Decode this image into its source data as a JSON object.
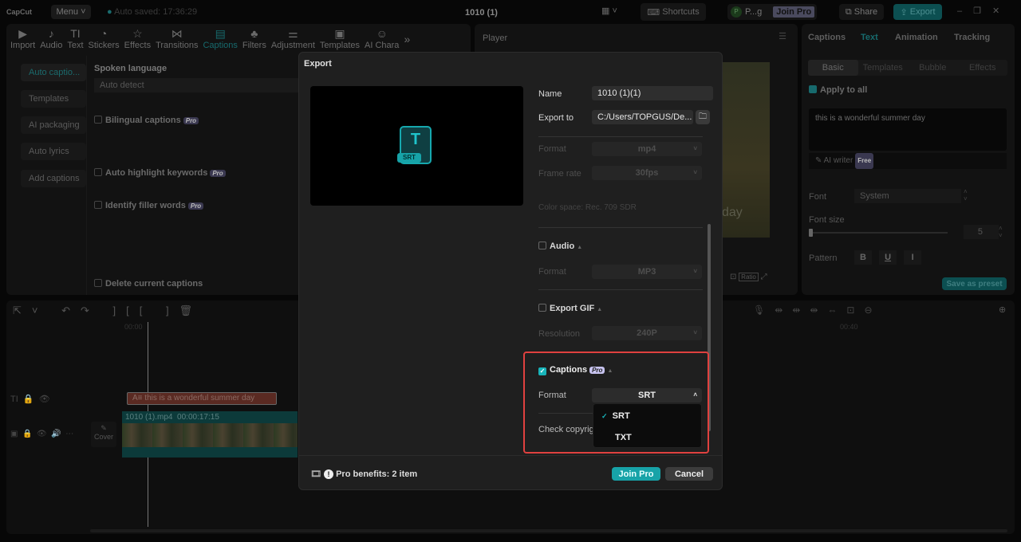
{
  "app": {
    "logo": "CapCut",
    "menu": "Menu",
    "autosave": "Auto saved: 17:36:29",
    "project_title": "1010 (1)",
    "shortcuts": "Shortcuts",
    "user": "P...g",
    "user_initial": "P",
    "join_pro": "Join Pro",
    "share": "Share",
    "export": "Export",
    "accent": "#1fb5b9"
  },
  "toolbar": [
    {
      "label": "Import",
      "icon": "▶"
    },
    {
      "label": "Audio",
      "icon": "♪"
    },
    {
      "label": "Text",
      "icon": "TI"
    },
    {
      "label": "Stickers",
      "icon": "◔"
    },
    {
      "label": "Effects",
      "icon": "☆"
    },
    {
      "label": "Transitions",
      "icon": "⋈"
    },
    {
      "label": "Captions",
      "icon": "▤",
      "active": true
    },
    {
      "label": "Filters",
      "icon": "♣"
    },
    {
      "label": "Adjustment",
      "icon": "⚌"
    },
    {
      "label": "Templates",
      "icon": "▣"
    },
    {
      "label": "AI Chara",
      "icon": "☺"
    }
  ],
  "captions_panel": {
    "side": [
      "Auto captio...",
      "Templates",
      "AI packaging",
      "Auto lyrics",
      "Add captions"
    ],
    "spoken_language": "Spoken language",
    "language_value": "Auto detect",
    "bilingual": "Bilingual captions",
    "highlight": "Auto highlight keywords",
    "filler": "Identify filler words",
    "delete": "Delete current captions",
    "pro": "Pro"
  },
  "player": {
    "title": "Player",
    "ratio": "Ratio",
    "overlay_text": "day"
  },
  "right_panel": {
    "tabs": [
      "Captions",
      "Text",
      "Animation",
      "Tracking"
    ],
    "active_tab": "Text",
    "subtabs": [
      "Basic",
      "Templates",
      "Bubble",
      "Effects"
    ],
    "apply_all": "Apply to all",
    "text": "this is a wonderful summer day",
    "ai_writer": "AI writer",
    "free": "Free",
    "font_label": "Font",
    "font_value": "System",
    "size_label": "Font size",
    "size_value": "5",
    "pattern_label": "Pattern",
    "save_preset": "Save as preset"
  },
  "timeline": {
    "time_start": "00:00",
    "time_end": "00:40",
    "caption_clip": "this is a wonderful summer day",
    "video_name": "1010 (1).mp4",
    "video_duration": "00:00:17:15",
    "cover": "Cover"
  },
  "export_dialog": {
    "title": "Export",
    "thumb_label": "SRT",
    "name_label": "Name",
    "name_value": "1010 (1)(1)",
    "export_to_label": "Export to",
    "export_to_value": "C:/Users/TOPGUS/De...",
    "format_label": "Format",
    "format_value": "mp4",
    "framerate_label": "Frame rate",
    "framerate_value": "30fps",
    "color_space": "Color space: Rec. 709 SDR",
    "audio_label": "Audio",
    "audio_format": "MP3",
    "gif_label": "Export GIF",
    "resolution_label": "Resolution",
    "resolution_value": "240P",
    "captions_label": "Captions",
    "captions_format": "SRT",
    "dropdown_options": [
      "SRT",
      "TXT"
    ],
    "selected_option": "SRT",
    "check_copyright": "Check copyright",
    "pro_benefits": "Pro benefits: 2 item",
    "join_pro": "Join Pro",
    "cancel": "Cancel",
    "highlight_color": "#e0413f"
  }
}
